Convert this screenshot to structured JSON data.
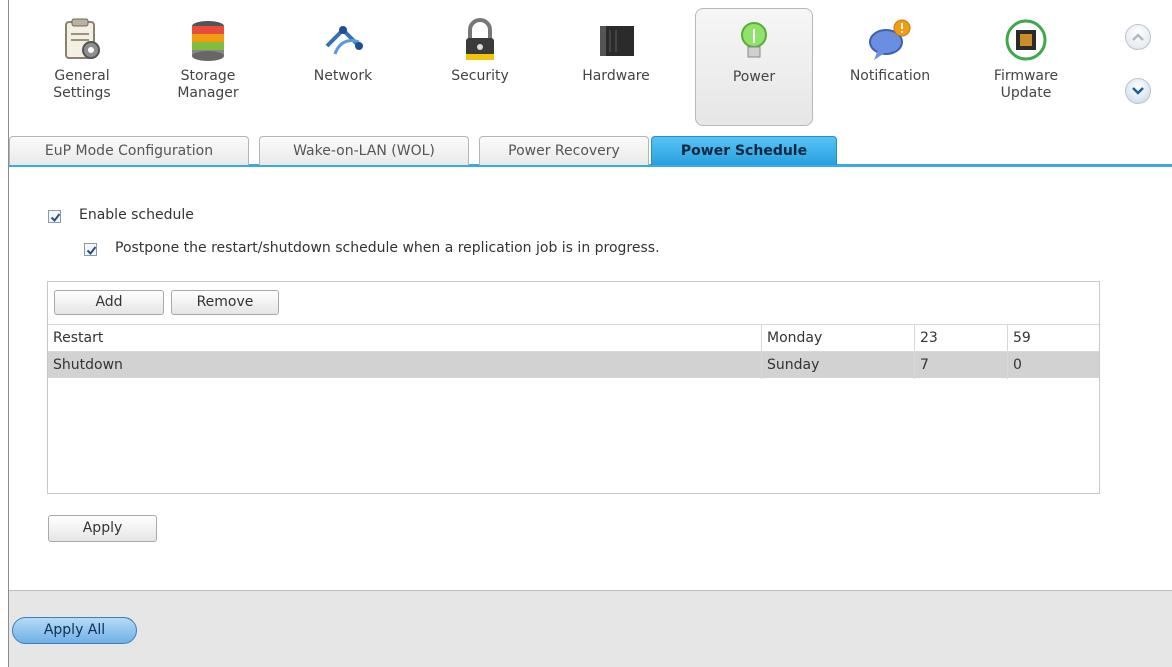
{
  "toolbar": {
    "items": [
      {
        "label_line1": "General",
        "label_line2": "Settings",
        "icon": "general-settings-icon"
      },
      {
        "label_line1": "Storage",
        "label_line2": "Manager",
        "icon": "storage-manager-icon"
      },
      {
        "label_line1": "Network",
        "label_line2": "",
        "icon": "network-icon"
      },
      {
        "label_line1": "Security",
        "label_line2": "",
        "icon": "lock-icon"
      },
      {
        "label_line1": "Hardware",
        "label_line2": "",
        "icon": "hardware-icon"
      },
      {
        "label_line1": "Power",
        "label_line2": "",
        "icon": "power-bulb-icon"
      },
      {
        "label_line1": "Notification",
        "label_line2": "",
        "icon": "notification-icon"
      },
      {
        "label_line1": "Firmware",
        "label_line2": "Update",
        "icon": "firmware-update-icon"
      }
    ],
    "active_index": 5
  },
  "subtabs": [
    {
      "label": "EuP Mode Configuration"
    },
    {
      "label": "Wake-on-LAN (WOL)"
    },
    {
      "label": "Power Recovery"
    },
    {
      "label": "Power Schedule"
    }
  ],
  "options": {
    "enable_schedule": "Enable schedule",
    "postpone": "Postpone the restart/shutdown schedule when a replication job is in progress."
  },
  "grid": {
    "add_label": "Add",
    "remove_label": "Remove",
    "rows": [
      {
        "action": "Restart",
        "day": "Monday",
        "hour": "23",
        "minute": "59"
      },
      {
        "action": "Shutdown",
        "day": "Sunday",
        "hour": "7",
        "minute": "0"
      }
    ]
  },
  "apply_label": "Apply",
  "apply_all_label": "Apply All",
  "colors": {
    "accent": "#2ea3e3",
    "selected_row": "#d2d2d2"
  }
}
